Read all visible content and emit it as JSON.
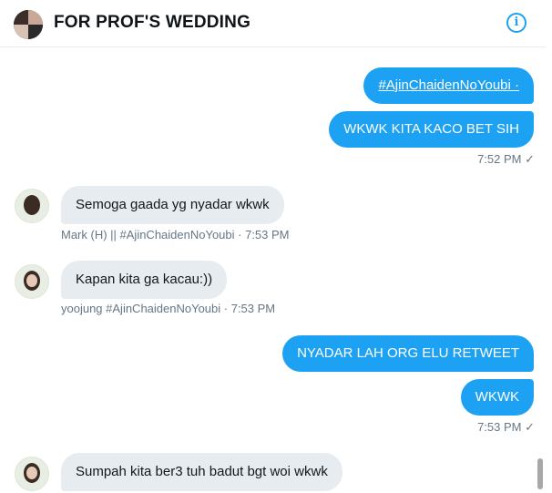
{
  "header": {
    "title": "FOR PROF'S WEDDING",
    "info_icon": "i"
  },
  "messages": {
    "out1": {
      "text": "#AjinChaidenNoYoubi ·"
    },
    "out2": {
      "text": "WKWK KITA KACO BET SIH"
    },
    "out2_time": "7:52 PM ✓",
    "in1": {
      "text": "Semoga gaada yg nyadar wkwk",
      "meta": "Mark (H) || #AjinChaidenNoYoubi · 7:53 PM"
    },
    "in2": {
      "text": "Kapan kita ga kacau:))",
      "meta": "yoojung #AjinChaidenNoYoubi · 7:53 PM"
    },
    "out3": {
      "text": "NYADAR LAH ORG ELU RETWEET"
    },
    "out4": {
      "text": "WKWK"
    },
    "out4_time": "7:53 PM ✓",
    "in3": {
      "text": "Sumpah kita ber3 tuh badut bgt woi wkwk"
    }
  },
  "colors": {
    "accent": "#1da1f2",
    "incoming_bubble": "#e6ecf0",
    "meta_text": "#657786"
  }
}
